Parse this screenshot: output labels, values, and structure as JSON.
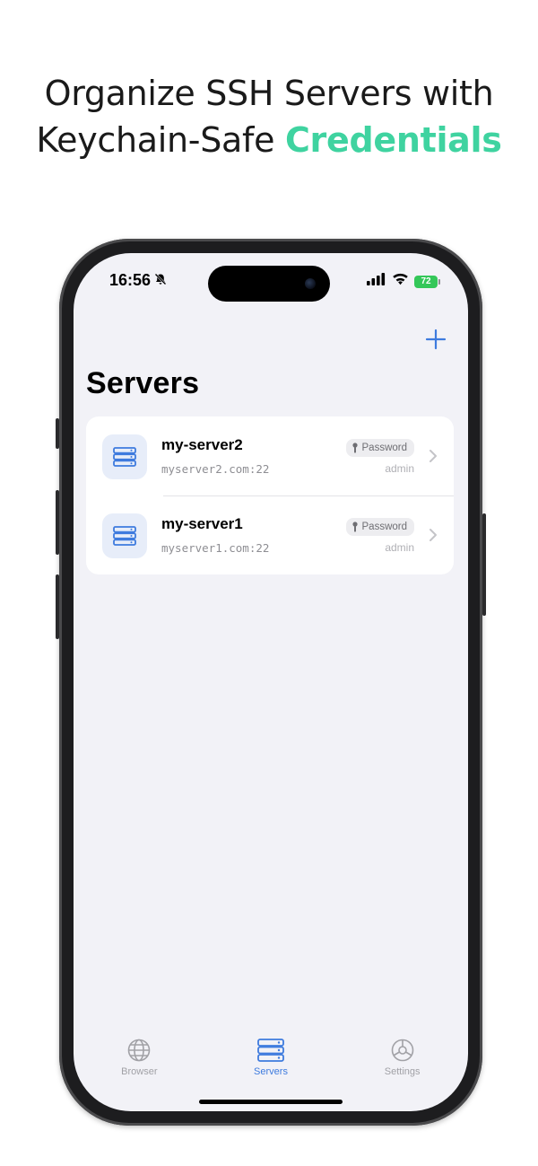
{
  "headline": {
    "line1": "Organize SSH Servers with",
    "line2_prefix": "Keychain-Safe ",
    "line2_accent": "Credentials",
    "accent_color": "#3fd3a0"
  },
  "status_bar": {
    "time": "16:56",
    "battery": "72",
    "icons": [
      "bell-slash-icon",
      "cellular-signal-icon",
      "wifi-icon",
      "battery-icon"
    ]
  },
  "screen": {
    "title": "Servers",
    "add_icon": "plus-icon",
    "accent_color": "#3e7bde"
  },
  "servers": [
    {
      "name": "my-server2",
      "host": "myserver2.com:22",
      "auth": "Password",
      "user": "admin",
      "icon": "server-rack-icon"
    },
    {
      "name": "my-server1",
      "host": "myserver1.com:22",
      "auth": "Password",
      "user": "admin",
      "icon": "server-rack-icon"
    }
  ],
  "tabs": [
    {
      "label": "Browser",
      "icon": "globe-icon",
      "active": false
    },
    {
      "label": "Servers",
      "icon": "server-rack-icon",
      "active": true
    },
    {
      "label": "Settings",
      "icon": "gear-icon",
      "active": false
    }
  ]
}
